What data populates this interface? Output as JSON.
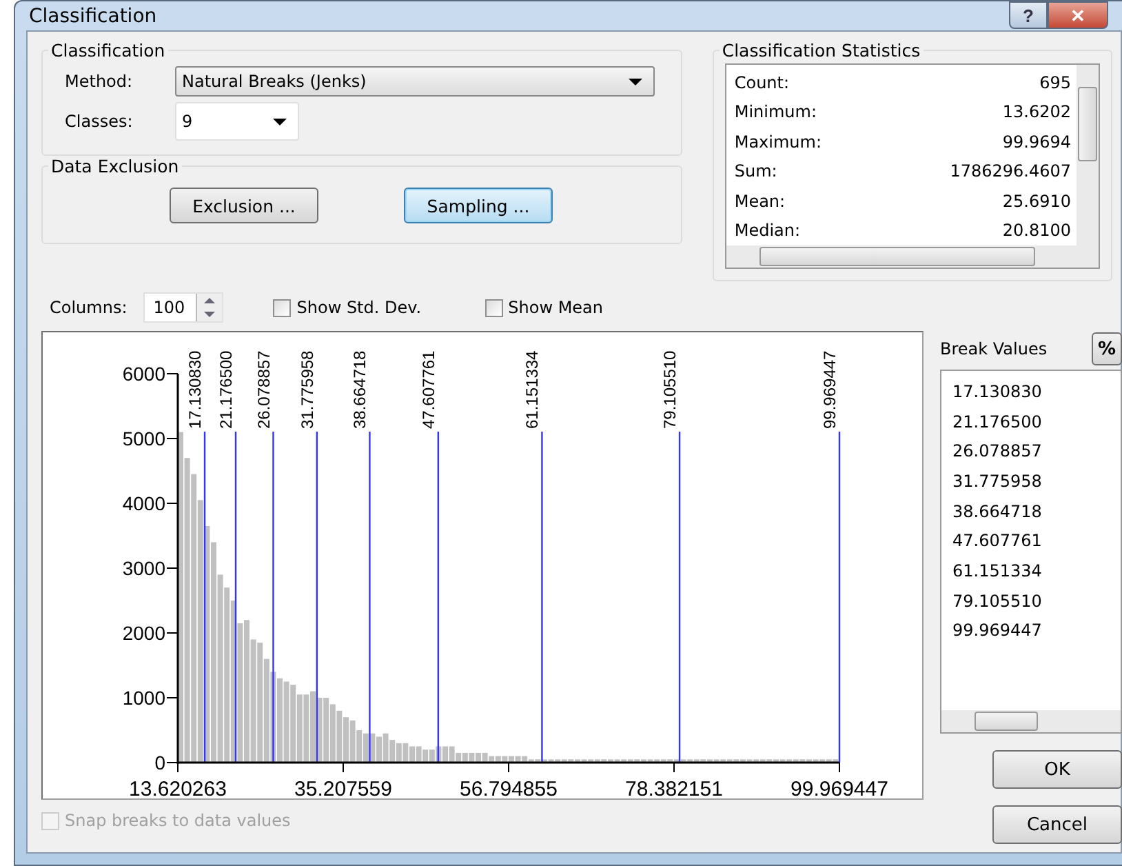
{
  "window": {
    "title": "Classification",
    "help_button": "?",
    "close_button": "✕"
  },
  "classification": {
    "title": "Classification",
    "method_label": "Method:",
    "method": "Natural Breaks (Jenks)",
    "classes_label": "Classes:",
    "classes": "9"
  },
  "data_exclusion": {
    "title": "Data Exclusion",
    "buttons": [
      {
        "label": "Exclusion ...",
        "focused": false
      },
      {
        "label": "Sampling ...",
        "focused": true
      }
    ]
  },
  "statistics": {
    "title": "Classification Statistics",
    "rows": [
      {
        "label": "Count:",
        "value": "695"
      },
      {
        "label": "Minimum:",
        "value": "13.6202"
      },
      {
        "label": "Maximum:",
        "value": "99.9694"
      },
      {
        "label": "Sum:",
        "value": "1786296.4607"
      },
      {
        "label": "Mean:",
        "value": "25.6910"
      },
      {
        "label": "Median:",
        "value": "20.8100"
      }
    ]
  },
  "columns": {
    "label": "Columns:",
    "value": "100"
  },
  "options": [
    {
      "label": "Show Std. Dev.",
      "checked": false,
      "disabled": false
    },
    {
      "label": "Show Mean",
      "checked": false,
      "disabled": false
    }
  ],
  "histogram": {
    "x_labels": [
      "13.620263",
      "35.207559",
      "56.794855",
      "78.382151",
      "99.969447"
    ],
    "break_lines": [
      "17.130830",
      "21.176500",
      "26.078857",
      "31.775958",
      "38.664718",
      "47.607761",
      "61.151334",
      "79.105510",
      "99.969447"
    ],
    "chart_data": {
      "type": "bar",
      "ylim": [
        0,
        6000
      ],
      "yticks": [
        0,
        1000,
        2000,
        3000,
        4000,
        5000,
        6000
      ],
      "values": [
        5100,
        4700,
        4450,
        4050,
        3650,
        3400,
        2900,
        2700,
        2500,
        2150,
        2200,
        1900,
        1850,
        1600,
        1400,
        1300,
        1250,
        1200,
        1050,
        1050,
        1100,
        1000,
        1000,
        900,
        800,
        700,
        650,
        500,
        450,
        450,
        400,
        450,
        350,
        300,
        300,
        250,
        250,
        200,
        200,
        250,
        250,
        250,
        150,
        150,
        150,
        150,
        150,
        100,
        100,
        100,
        100,
        100,
        100,
        50,
        50,
        50,
        50,
        50,
        50,
        50,
        50,
        50,
        50,
        50,
        50,
        50,
        50,
        50,
        50,
        50,
        50,
        50,
        50,
        50,
        50,
        50,
        50,
        50,
        50,
        50,
        50,
        50,
        50,
        50,
        50,
        50,
        50,
        50,
        50,
        50,
        50,
        50,
        50,
        50,
        50,
        50,
        50,
        50,
        50,
        50
      ]
    }
  },
  "snap": {
    "label": "Snap breaks to data values",
    "checked": false,
    "disabled": true
  },
  "break_values": {
    "title": "Break Values",
    "percent_button": "%",
    "values": [
      "17.130830",
      "21.176500",
      "26.078857",
      "31.775958",
      "38.664718",
      "47.607761",
      "61.151334",
      "79.105510",
      "99.969447"
    ]
  },
  "buttons": [
    "OK",
    "Cancel"
  ]
}
